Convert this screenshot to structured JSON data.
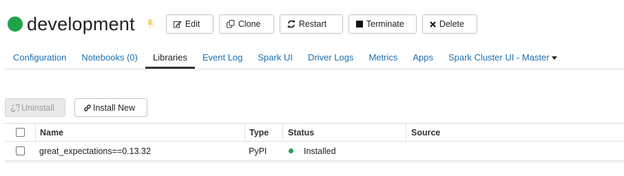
{
  "cluster": {
    "name": "development",
    "status_color": "#1fa34a",
    "pin_icon": "pin-icon"
  },
  "toolbar": {
    "edit_label": "Edit",
    "clone_label": "Clone",
    "restart_label": "Restart",
    "terminate_label": "Terminate",
    "delete_label": "Delete"
  },
  "tabs": [
    {
      "label": "Configuration"
    },
    {
      "label": "Notebooks (0)"
    },
    {
      "label": "Libraries",
      "active": true
    },
    {
      "label": "Event Log"
    },
    {
      "label": "Spark UI"
    },
    {
      "label": "Driver Logs"
    },
    {
      "label": "Metrics"
    },
    {
      "label": "Apps"
    },
    {
      "label": "Spark Cluster UI - Master"
    }
  ],
  "libraries": {
    "uninstall_label": "Uninstall",
    "install_new_label": "Install New",
    "columns": [
      "Name",
      "Type",
      "Status",
      "Source"
    ],
    "rows": [
      {
        "name": "great_expectations==0.13.32",
        "type": "PyPI",
        "status": "Installed",
        "source": "",
        "status_color": "#1fa34a"
      }
    ]
  },
  "colors": {
    "link": "#1a6fb0",
    "active_tab_underline": "#333333",
    "status_green": "#1fa34a"
  }
}
